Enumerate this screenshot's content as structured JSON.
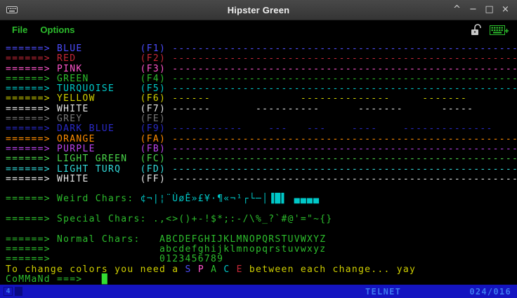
{
  "window": {
    "title": "Hipster Green",
    "controls": {
      "shade": "^",
      "minimize": "−",
      "maximize": "□",
      "close": "×"
    }
  },
  "menu": {
    "file": "File",
    "options": "Options"
  },
  "palette": {
    "blue": "#4d4dff",
    "red": "#c62838",
    "pink": "#ff55cc",
    "green": "#2dbe2d",
    "turquoise": "#00c8c8",
    "yellow": "#d0d000",
    "white": "#e6e6e6",
    "grey": "#767676",
    "darkblue": "#2a2ac8",
    "orange": "#ff8c00",
    "purple": "#bb44ee",
    "lightgreen": "#4ad84a",
    "lightturq": "#33dcdc",
    "cursor": "#33dd33"
  },
  "terminal": {
    "rows": [
      {
        "segments": [
          {
            "t": "======> BLUE         (F1) ------------------------------------------------------",
            "c": "blue"
          }
        ]
      },
      {
        "segments": [
          {
            "t": "======> RED          (F2) ------------------------------------------------------",
            "c": "red"
          }
        ]
      },
      {
        "segments": [
          {
            "t": "======> PINK         (F3) ------------------------------------------------------",
            "c": "pink"
          }
        ]
      },
      {
        "segments": [
          {
            "t": "======> GREEN        (F4) ------------------------------------------------------",
            "c": "green"
          }
        ]
      },
      {
        "segments": [
          {
            "t": "======> TURQUOISE    (F5) ------------------------------------------------------",
            "c": "turquoise"
          }
        ]
      },
      {
        "segments": [
          {
            "t": "======> YELLOW       (F6) ------              --------------     -------",
            "c": "yellow"
          }
        ]
      },
      {
        "segments": [
          {
            "t": "======> WHITE        (F7) ------       ----------      -------      -----",
            "c": "white"
          }
        ]
      },
      {
        "segments": [
          {
            "t": "======> GREY         (FE)",
            "c": "grey"
          }
        ]
      },
      {
        "segments": [
          {
            "t": "======> DARK BLUE    (F9) -----------    ---   ---    ----    --------------",
            "c": "darkblue"
          }
        ]
      },
      {
        "segments": [
          {
            "t": "======> ORANGE       (FA) ------------------------------------------------------",
            "c": "orange"
          }
        ]
      },
      {
        "segments": [
          {
            "t": "======> PURPLE       (FB) ------------------------------------------------------",
            "c": "purple"
          }
        ]
      },
      {
        "segments": [
          {
            "t": "======> LIGHT GREEN  (FC) ------------------------------------------------------",
            "c": "lightgreen"
          }
        ]
      },
      {
        "segments": [
          {
            "t": "======> LIGHT TURQ   (FD) ------------------------------------------------------",
            "c": "lightturq"
          }
        ]
      },
      {
        "segments": [
          {
            "t": "======> WHITE        (FF) ------------------------------------------------------",
            "c": "white"
          }
        ]
      },
      {
        "segments": []
      },
      {
        "segments": [
          {
            "t": "======> Weird Chars: ",
            "c": "green"
          },
          {
            "t": "¢¬|¦¨ÙøÊ»£¥·¶«¬¹┌└─│▐█▌ ▄▄▄▄",
            "c": "turquoise"
          }
        ]
      },
      {
        "segments": []
      },
      {
        "segments": [
          {
            "t": "======> Special Chars: .,<>()+-!$*;:-/\\%_?`#@'=\"~{}",
            "c": "green"
          }
        ]
      },
      {
        "segments": []
      },
      {
        "segments": [
          {
            "t": "======> Normal Chars:   ABCDEFGHIJKLMNOPQRSTUVWXYZ",
            "c": "green"
          }
        ]
      },
      {
        "segments": [
          {
            "t": "======>                 abcdefghijklmnopqrstuvwxyz",
            "c": "green"
          }
        ]
      },
      {
        "segments": [
          {
            "t": "======>                 0123456789",
            "c": "green"
          }
        ]
      },
      {
        "segments": [
          {
            "t": "To change colors you need a ",
            "c": "yellow"
          },
          {
            "t": "S ",
            "c": "blue"
          },
          {
            "t": "P ",
            "c": "pink"
          },
          {
            "t": "A ",
            "c": "green"
          },
          {
            "t": "C ",
            "c": "turquoise"
          },
          {
            "t": "E ",
            "c": "red"
          },
          {
            "t": "between each change... yay",
            "c": "yellow"
          }
        ]
      },
      {
        "segments": [
          {
            "t": "CoMMaNd ===>   ",
            "c": "green"
          },
          {
            "t": "█",
            "c": "cursor"
          }
        ]
      }
    ]
  },
  "status": {
    "indicator": "4",
    "protocol": "TELNET",
    "cursor_position": "024/016"
  }
}
